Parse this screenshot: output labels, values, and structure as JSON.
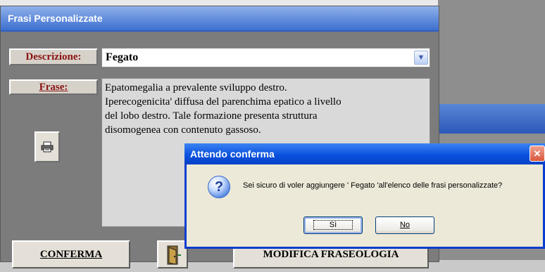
{
  "main_window": {
    "title": "Frasi Personalizzate",
    "descrizione_label": "Descrizione:",
    "descrizione_value": "Fegato",
    "frase_label": "Frase:",
    "frase_text": "Epatomegalia a prevalente sviluppo destro.\nIperecogenicita' diffusa del parenchima epatico a livello\ndel lobo destro. Tale formazione presenta struttura\ndisomogenea con contenuto gassoso.",
    "conferma_label": "CONFERMA",
    "modifica_label": "MODIFICA FRASEOLOGIA",
    "icons": [
      "printer-icon",
      "exit-door-icon",
      "dropdown-arrow-icon"
    ]
  },
  "dialog": {
    "title": "Attendo conferma",
    "message": "Sei sicuro di voler aggiungere ' Fegato 'all'elenco delle frasi personalizzate?",
    "yes_label": "Sì",
    "no_label": "No",
    "icon": "question-icon"
  },
  "colors": {
    "title_bar": "#3d6fd0",
    "label_text": "#8a1313",
    "dialog_title": "#0a52de"
  }
}
